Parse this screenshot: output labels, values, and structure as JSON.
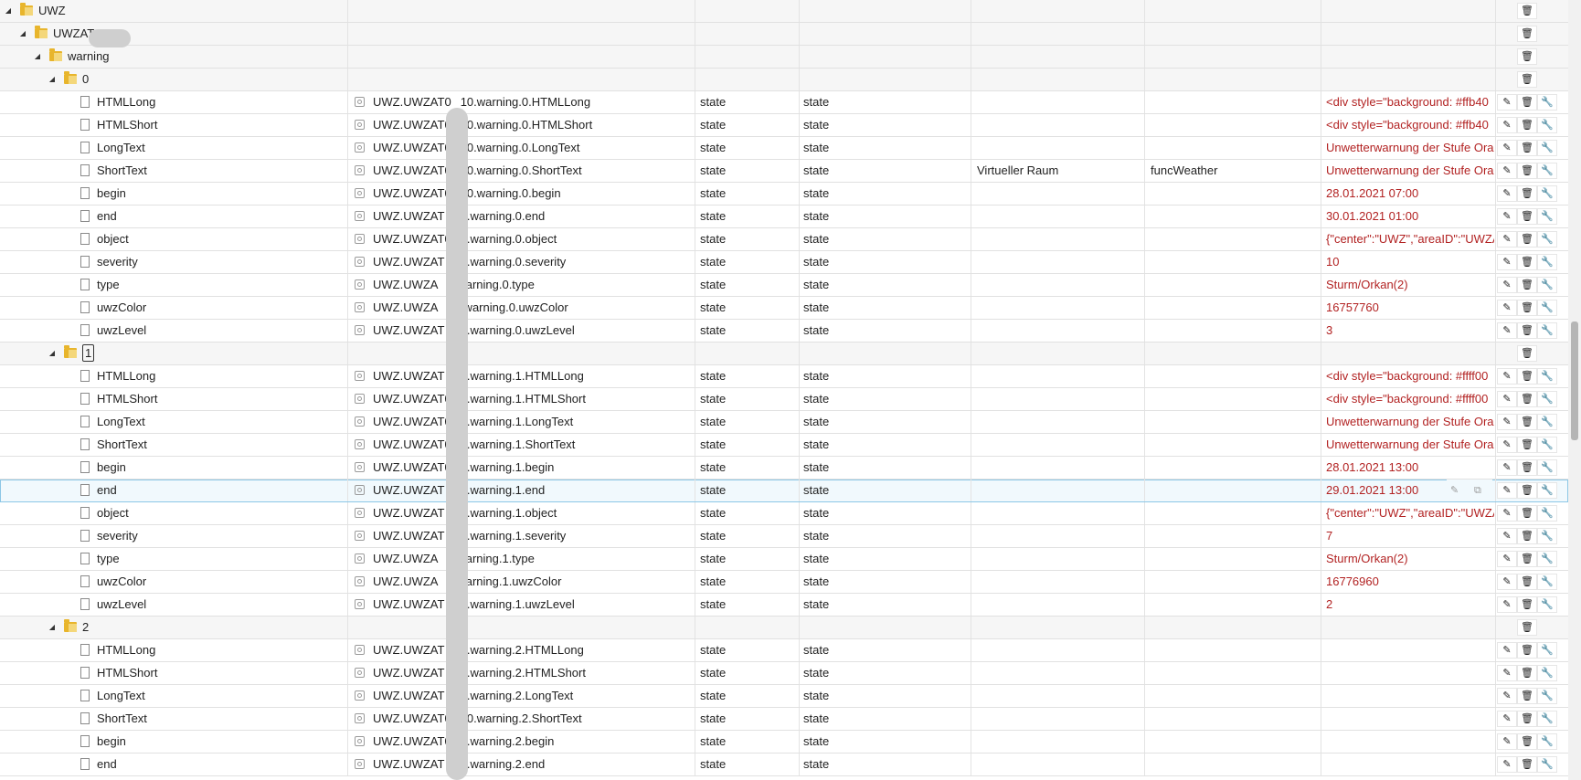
{
  "rows": [
    {
      "depth": 0,
      "kind": "folder",
      "name": "UWZ"
    },
    {
      "depth": 1,
      "kind": "folder",
      "name": "UWZAT"
    },
    {
      "depth": 2,
      "kind": "folder",
      "name": "warning"
    },
    {
      "depth": 3,
      "kind": "folder",
      "name": "0"
    },
    {
      "depth": 4,
      "kind": "state",
      "name": "HTMLLong",
      "id": "UWZ.UWZAT0",
      "id_tail": "10.warning.0.HTMLLong",
      "type": "state",
      "role": "state",
      "value": "<div style=\"background: #ffb40"
    },
    {
      "depth": 4,
      "kind": "state",
      "name": "HTMLShort",
      "id": "UWZ.UWZAT00",
      "id_tail": "0.warning.0.HTMLShort",
      "type": "state",
      "role": "state",
      "value": "<div style=\"background: #ffb40"
    },
    {
      "depth": 4,
      "kind": "state",
      "name": "LongText",
      "id": "UWZ.UWZAT00",
      "id_tail": "0.warning.0.LongText",
      "type": "state",
      "role": "state",
      "value": "Unwetterwarnung der Stufe Orange"
    },
    {
      "depth": 4,
      "kind": "state",
      "name": "ShortText",
      "id": "UWZ.UWZAT0",
      "id_tail": "10.warning.0.ShortText",
      "type": "state",
      "role": "state",
      "room": "Virtueller Raum",
      "func": "funcWeather",
      "value": "Unwetterwarnung der Stufe Orange"
    },
    {
      "depth": 4,
      "kind": "state",
      "name": "begin",
      "id": "UWZ.UWZAT0",
      "id_tail": "10.warning.0.begin",
      "type": "state",
      "role": "state",
      "value": "28.01.2021 07:00"
    },
    {
      "depth": 4,
      "kind": "state",
      "name": "end",
      "id": "UWZ.UWZAT",
      "id_tail": "10.warning.0.end",
      "type": "state",
      "role": "state",
      "value": "30.01.2021 01:00"
    },
    {
      "depth": 4,
      "kind": "state",
      "name": "object",
      "id": "UWZ.UWZAT0",
      "id_tail": "0.warning.0.object",
      "type": "state",
      "role": "state",
      "value": "{\"center\":\"UWZ\",\"areaID\":\"UWZA"
    },
    {
      "depth": 4,
      "kind": "state",
      "name": "severity",
      "id": "UWZ.UWZAT",
      "id_tail": "10.warning.0.severity",
      "type": "state",
      "role": "state",
      "value": "10"
    },
    {
      "depth": 4,
      "kind": "state",
      "name": "type",
      "id": "UWZ.UWZA",
      "id_tail": "0.warning.0.type",
      "type": "state",
      "role": "state",
      "value": "Sturm/Orkan(2)"
    },
    {
      "depth": 4,
      "kind": "state",
      "name": "uwzColor",
      "id": "UWZ.UWZA",
      "id_tail": "10.warning.0.uwzColor",
      "type": "state",
      "role": "state",
      "value": "16757760"
    },
    {
      "depth": 4,
      "kind": "state",
      "name": "uwzLevel",
      "id": "UWZ.UWZAT",
      "id_tail": "10.warning.0.uwzLevel",
      "type": "state",
      "role": "state",
      "value": "3"
    },
    {
      "depth": 3,
      "kind": "folder",
      "name": "1",
      "boxed": true
    },
    {
      "depth": 4,
      "kind": "state",
      "name": "HTMLLong",
      "id": "UWZ.UWZAT",
      "id_tail": "10.warning.1.HTMLLong",
      "type": "state",
      "role": "state",
      "value": "<div style=\"background: #ffff00"
    },
    {
      "depth": 4,
      "kind": "state",
      "name": "HTMLShort",
      "id": "UWZ.UWZAT0",
      "id_tail": "0.warning.1.HTMLShort",
      "type": "state",
      "role": "state",
      "value": "<div style=\"background: #ffff00"
    },
    {
      "depth": 4,
      "kind": "state",
      "name": "LongText",
      "id": "UWZ.UWZAT0",
      "id_tail": "0.warning.1.LongText",
      "type": "state",
      "role": "state",
      "value": "Unwetterwarnung der Stufe Orange"
    },
    {
      "depth": 4,
      "kind": "state",
      "name": "ShortText",
      "id": "UWZ.UWZAT0",
      "id_tail": "0.warning.1.ShortText",
      "type": "state",
      "role": "state",
      "value": "Unwetterwarnung der Stufe Orange"
    },
    {
      "depth": 4,
      "kind": "state",
      "name": "begin",
      "id": "UWZ.UWZAT0",
      "id_tail": "0.warning.1.begin",
      "type": "state",
      "role": "state",
      "value": "28.01.2021 13:00"
    },
    {
      "depth": 4,
      "kind": "state",
      "name": "end",
      "id": "UWZ.UWZAT",
      "id_tail": "10.warning.1.end",
      "type": "state",
      "role": "state",
      "value": "29.01.2021 13:00",
      "selected": true
    },
    {
      "depth": 4,
      "kind": "state",
      "name": "object",
      "id": "UWZ.UWZAT",
      "id_tail": "10.warning.1.object",
      "type": "state",
      "role": "state",
      "value": "{\"center\":\"UWZ\",\"areaID\":\"UWZA"
    },
    {
      "depth": 4,
      "kind": "state",
      "name": "severity",
      "id": "UWZ.UWZAT",
      "id_tail": "10.warning.1.severity",
      "type": "state",
      "role": "state",
      "value": "7"
    },
    {
      "depth": 4,
      "kind": "state",
      "name": "type",
      "id": "UWZ.UWZA",
      "id_tail": "0.warning.1.type",
      "type": "state",
      "role": "state",
      "value": "Sturm/Orkan(2)"
    },
    {
      "depth": 4,
      "kind": "state",
      "name": "uwzColor",
      "id": "UWZ.UWZA",
      "id_tail": "0.warning.1.uwzColor",
      "type": "state",
      "role": "state",
      "value": "16776960"
    },
    {
      "depth": 4,
      "kind": "state",
      "name": "uwzLevel",
      "id": "UWZ.UWZAT",
      "id_tail": "10.warning.1.uwzLevel",
      "type": "state",
      "role": "state",
      "value": "2"
    },
    {
      "depth": 3,
      "kind": "folder",
      "name": "2"
    },
    {
      "depth": 4,
      "kind": "state",
      "name": "HTMLLong",
      "id": "UWZ.UWZAT",
      "id_tail": "10.warning.2.HTMLLong",
      "type": "state",
      "role": "state",
      "value": ""
    },
    {
      "depth": 4,
      "kind": "state",
      "name": "HTMLShort",
      "id": "UWZ.UWZAT",
      "id_tail": "10.warning.2.HTMLShort",
      "type": "state",
      "role": "state",
      "value": ""
    },
    {
      "depth": 4,
      "kind": "state",
      "name": "LongText",
      "id": "UWZ.UWZAT",
      "id_tail": "10.warning.2.LongText",
      "type": "state",
      "role": "state",
      "value": ""
    },
    {
      "depth": 4,
      "kind": "state",
      "name": "ShortText",
      "id": "UWZ.UWZAT0",
      "id_tail": "10.warning.2.ShortText",
      "type": "state",
      "role": "state",
      "value": ""
    },
    {
      "depth": 4,
      "kind": "state",
      "name": "begin",
      "id": "UWZ.UWZAT0",
      "id_tail": "0.warning.2.begin",
      "type": "state",
      "role": "state",
      "value": ""
    },
    {
      "depth": 4,
      "kind": "state",
      "name": "end",
      "id": "UWZ.UWZAT",
      "id_tail": "10.warning.2.end",
      "type": "state",
      "role": "state",
      "value": ""
    }
  ],
  "icons": {
    "collapse_toggle": "◢",
    "edit": "✎",
    "delete": "🗑",
    "settings": "🔧",
    "copy": "⧉"
  }
}
